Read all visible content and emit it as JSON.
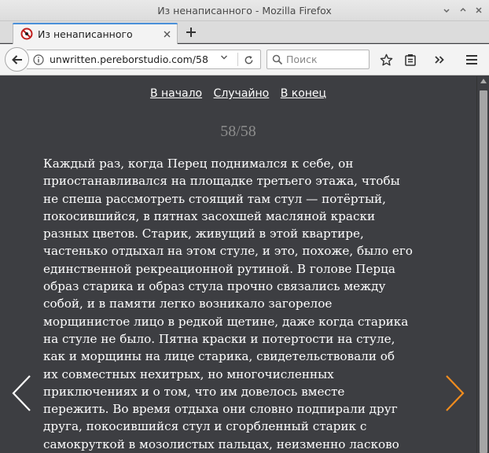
{
  "window": {
    "title": "Из ненаписанного - Mozilla Firefox"
  },
  "tab": {
    "title": "Из ненаписанного"
  },
  "navbar": {
    "url": "unwritten.pereborstudio.com/58",
    "search_placeholder": "Поиск"
  },
  "page": {
    "links": {
      "start": "В начало",
      "random": "Случайно",
      "end": "В конец"
    },
    "counter": "58/58",
    "story_lines": [
      "Каждый раз, когда Перец поднимался к себе, он",
      "приостанавливался на площадке третьего этажа, чтобы",
      "не спеша рассмотреть стоящий там стул — потёртый,",
      "покосившийся, в пятнах засохшей масляной краски",
      "разных цветов. Старик, живущий в этой квартире,",
      "частенько отдыхал на этом стуле, и это, похоже, было его",
      "единственной рекреационной рутиной. В голове Перца",
      "образ старика и образ стула прочно связались между",
      "собой, и в памяти легко возникало загорелое",
      "морщинистое лицо в редкой щетине, даже когда старика",
      "на стуле не было. Пятна краски и потертости на стуле,",
      "как и морщины на лице старика, свидетельствовали об",
      "их совместных нехитрых, но многочисленных",
      "приключениях и о том, что им довелось вместе",
      "пережить. Во время отдыха они словно подпирали друг",
      "друга, покосившийся стул и сгорбленный старик с",
      "самокруткой в мозолистых пальцах, неизменно ласково"
    ]
  },
  "colors": {
    "page_background": "#3d3e42",
    "text": "#ffffff",
    "counter": "#8d8d8d",
    "prev_arrow": "#ffffff",
    "next_arrow": "#f08c1e",
    "tab_accent": "#4a90d9"
  },
  "icons": {
    "favicon": "no-entry-icon",
    "back": "arrow-left-icon",
    "info": "info-icon",
    "reload": "reload-icon",
    "search": "search-icon",
    "bookmark": "star-icon",
    "reading_list": "clipboard-icon",
    "overflow": "chevron-double-right-icon",
    "menu": "hamburger-icon",
    "prev": "chevron-left-icon",
    "next": "chevron-right-icon"
  }
}
